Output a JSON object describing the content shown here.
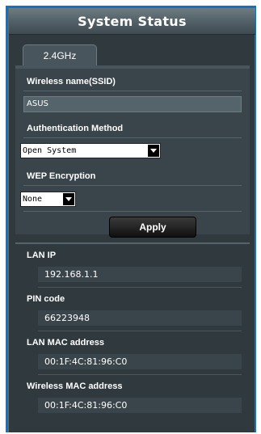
{
  "header": {
    "title": "System Status"
  },
  "tabs": [
    {
      "label": "2.4GHz",
      "selected": true
    }
  ],
  "wireless": {
    "ssid_label": "Wireless name(SSID)",
    "ssid_value": "ASUS",
    "auth_label": "Authentication Method",
    "auth_value": "Open System",
    "wep_label": "WEP Encryption",
    "wep_value": "None",
    "apply_label": "Apply"
  },
  "info": {
    "lan_ip_label": "LAN IP",
    "lan_ip_value": "192.168.1.1",
    "pin_label": "PIN code",
    "pin_value": "66223948",
    "lan_mac_label": "LAN MAC address",
    "lan_mac_value": "00:1F:4C:81:96:C0",
    "wireless_mac_label": "Wireless MAC address",
    "wireless_mac_value": "00:1F:4C:81:96:C0"
  },
  "colors": {
    "frame": "#0f74c9",
    "panel": "#303a3e",
    "section": "#3a454b"
  }
}
